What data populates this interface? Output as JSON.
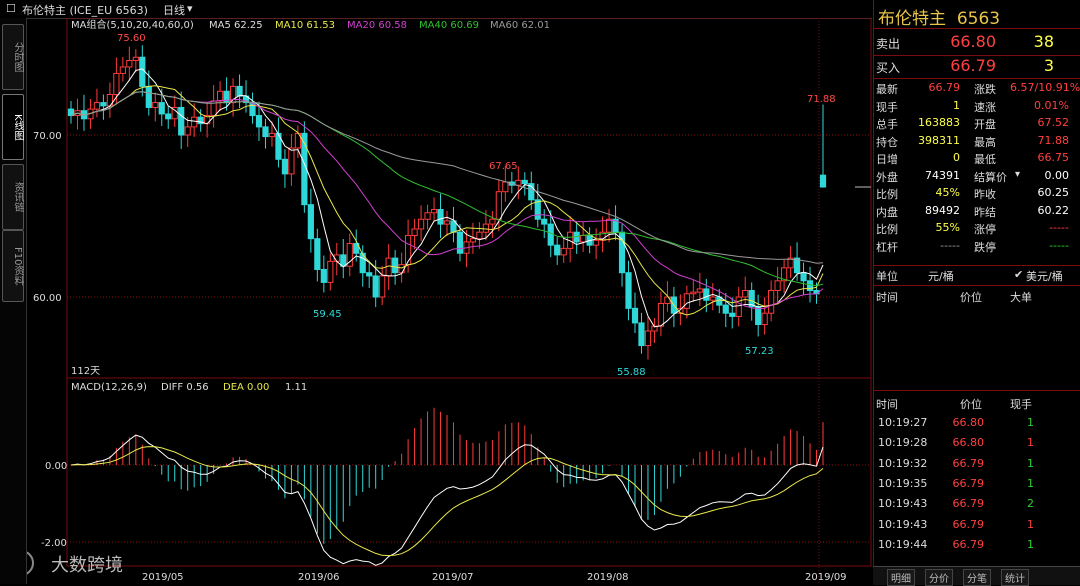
{
  "toolbar": {
    "title": "布伦特主 (ICE_EU 6563)",
    "period": "日线",
    "checkbox_glyph": "☐",
    "dropdown_glyph": "▾"
  },
  "left_tabs": [
    "分时图",
    "K线图",
    "资讯链",
    "F10资料"
  ],
  "legend": {
    "ma_group": "MA组合(5,10,20,40,60,0)",
    "ma5": "MA5 62.25",
    "ma10": "MA10 61.53",
    "ma20": "MA20 60.58",
    "ma40": "MA40 60.69",
    "ma60": "MA60 62.01",
    "days": "112天"
  },
  "macd_legend": {
    "name": "MACD(12,26,9)",
    "diff": "DIFF 0.56",
    "dea": "DEA 0.00",
    "macd": "1.11"
  },
  "colors": {
    "ma5": "#ffffff",
    "ma10": "#e8e84a",
    "ma20": "#d040d0",
    "ma40": "#30c030",
    "ma60": "#9a9a9a",
    "up": "#ff3a3a",
    "down": "#2fd8d8",
    "grid": "#8a0c0c",
    "panel_border": "#7a0c0c"
  },
  "chart_data": {
    "type": "candlestick",
    "ylim": [
      55,
      75
    ],
    "y_ticks": [
      "70.00",
      "60.00"
    ],
    "x_ticks": [
      "2019/05",
      "2019/06",
      "2019/07",
      "2019/08",
      "2019/09"
    ],
    "annotations": [
      "75.60",
      "59.45",
      "67.65",
      "55.88",
      "57.23",
      "71.88"
    ],
    "last_price_open": 67.52,
    "last_price_high": 71.88,
    "last_price_low": 66.75,
    "last_price_close": 66.79,
    "macd": {
      "y_ticks": [
        "0.00",
        "-2.00"
      ],
      "diff": 0.56,
      "dea": 0.0,
      "macd": 1.11
    }
  },
  "quote": {
    "title": "布伦特主",
    "code": "6563",
    "sell_label": "卖出",
    "sell_price": "66.80",
    "sell_vol": "38",
    "buy_label": "买入",
    "buy_price": "66.79",
    "buy_vol": "3",
    "left": [
      {
        "label": "最新",
        "value": "66.79",
        "color": "red"
      },
      {
        "label": "现手",
        "value": "1",
        "color": "yel"
      },
      {
        "label": "总手",
        "value": "163883",
        "color": "yel"
      },
      {
        "label": "持仓",
        "value": "398311",
        "color": "yel"
      },
      {
        "label": "日增",
        "value": "0",
        "color": "yel"
      },
      {
        "label": "外盘",
        "value": "74391",
        "color": "wht"
      },
      {
        "label": "比例",
        "value": "45%",
        "color": "yel"
      },
      {
        "label": "内盘",
        "value": "89492",
        "color": "wht"
      },
      {
        "label": "比例",
        "value": "55%",
        "color": "yel"
      },
      {
        "label": "杠杆",
        "value": "-----",
        "color": "gray"
      }
    ],
    "right": [
      {
        "label": "涨跌",
        "value": "6.57/10.91%",
        "color": "red"
      },
      {
        "label": "速涨",
        "value": "0.01%",
        "color": "red"
      },
      {
        "label": "开盘",
        "value": "67.52",
        "color": "red"
      },
      {
        "label": "最高",
        "value": "71.88",
        "color": "red"
      },
      {
        "label": "最低",
        "value": "66.75",
        "color": "red"
      },
      {
        "label": "结算价",
        "value": "0.00",
        "color": "wht"
      },
      {
        "label": "昨收",
        "value": "60.25",
        "color": "wht"
      },
      {
        "label": "昨结",
        "value": "60.22",
        "color": "wht"
      },
      {
        "label": "涨停",
        "value": "-----",
        "color": "red"
      },
      {
        "label": "跌停",
        "value": "-----",
        "color": "grn"
      }
    ],
    "unit_label": "单位",
    "unit_value": "元/桶",
    "unit_selected": "美元/桶",
    "check_glyph": "✔",
    "tick_header": {
      "time": "时间",
      "price": "价位",
      "big": "大单"
    },
    "trade_header": {
      "time": "时间",
      "price": "价位",
      "vol": "现手"
    },
    "trades": [
      {
        "time": "10:19:27",
        "price": "66.80",
        "vol": "1",
        "vcolor": "grn"
      },
      {
        "time": "10:19:28",
        "price": "66.80",
        "vol": "1",
        "vcolor": "red"
      },
      {
        "time": "10:19:32",
        "price": "66.79",
        "vol": "1",
        "vcolor": "grn"
      },
      {
        "time": "10:19:35",
        "price": "66.79",
        "vol": "1",
        "vcolor": "grn"
      },
      {
        "time": "10:19:43",
        "price": "66.79",
        "vol": "2",
        "vcolor": "grn"
      },
      {
        "time": "10:19:43",
        "price": "66.79",
        "vol": "1",
        "vcolor": "red"
      },
      {
        "time": "10:19:44",
        "price": "66.79",
        "vol": "1",
        "vcolor": "grn"
      }
    ],
    "bottom_tabs": [
      "明细",
      "分价",
      "分笔",
      "统计"
    ]
  },
  "watermark": "大数跨境"
}
